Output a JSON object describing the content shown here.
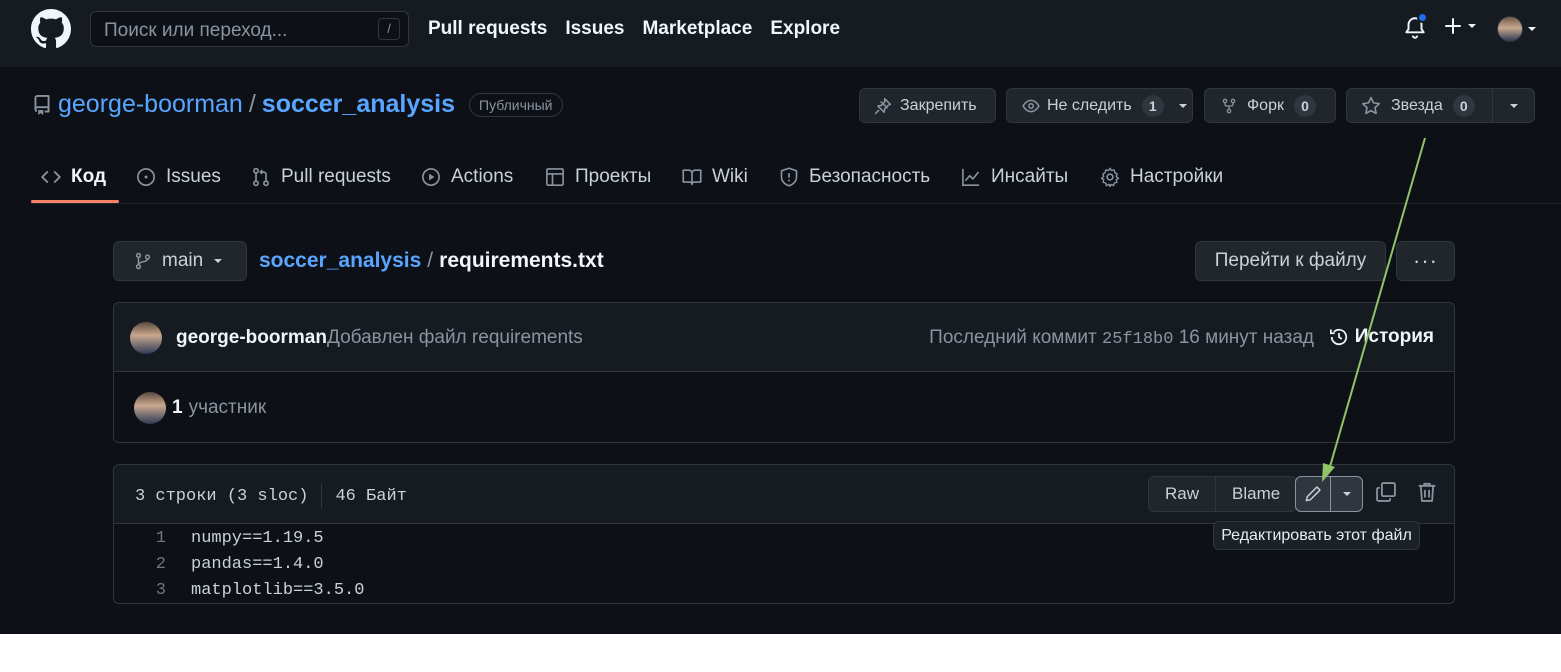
{
  "header": {
    "search_placeholder": "Поиск или переход...",
    "search_shortcut": "/",
    "nav": [
      "Pull requests",
      "Issues",
      "Marketplace",
      "Explore"
    ],
    "notification_color": "#1f6feb"
  },
  "repo": {
    "owner": "george-boorman",
    "separator": "/",
    "name": "soccer_analysis",
    "visibility": "Публичный",
    "pin_label": "Закрепить",
    "watch_label": "Не следить",
    "watch_count": "1",
    "fork_label": "Форк",
    "fork_count": "0",
    "star_label": "Звезда",
    "star_count": "0"
  },
  "tabs": [
    {
      "label": "Код",
      "icon": "code-icon",
      "active": true
    },
    {
      "label": "Issues",
      "icon": "issue-icon"
    },
    {
      "label": "Pull requests",
      "icon": "pull-request-icon"
    },
    {
      "label": "Actions",
      "icon": "play-icon"
    },
    {
      "label": "Проекты",
      "icon": "table-icon"
    },
    {
      "label": "Wiki",
      "icon": "book-icon"
    },
    {
      "label": "Безопасность",
      "icon": "shield-icon"
    },
    {
      "label": "Инсайты",
      "icon": "graph-icon"
    },
    {
      "label": "Настройки",
      "icon": "gear-icon"
    }
  ],
  "file_nav": {
    "branch": "main",
    "path_root": "soccer_analysis",
    "path_sep": "/",
    "file_name": "requirements.txt",
    "goto_label": "Перейти к файлу",
    "more_label": "···"
  },
  "commit": {
    "author": "george-boorman",
    "message": "Добавлен файл requirements",
    "last_commit_label": "Последний коммит",
    "sha": "25f18b0",
    "time_ago": "16 минут назад",
    "history_label": "История",
    "contributors_count": "1",
    "contributors_label": "участник"
  },
  "file": {
    "lines_info": "3 строки (3 sloc)",
    "size": "46 Байт",
    "raw_label": "Raw",
    "blame_label": "Blame",
    "tooltip": "Редактировать этот файл",
    "lines": [
      {
        "n": "1",
        "text": "numpy==1.19.5"
      },
      {
        "n": "2",
        "text": "pandas==1.4.0"
      },
      {
        "n": "3",
        "text": "matplotlib==3.5.0"
      }
    ]
  },
  "annotation_color": "#8fc46a"
}
